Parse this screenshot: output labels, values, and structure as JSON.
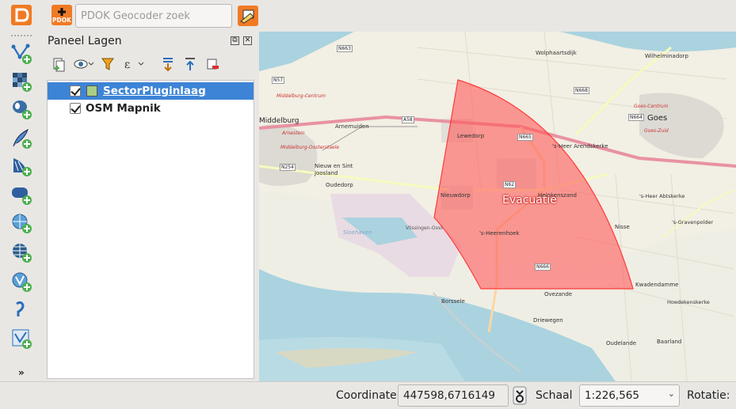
{
  "toolbar": {
    "search_placeholder": "PDOK Geocoder zoek",
    "pdok_badge": "PDOK",
    "icons": [
      "qgis-logo-icon",
      "pdok-plugin-icon",
      "clear-geocoder-icon"
    ]
  },
  "left_toolbar": {
    "icons": [
      "add-vector-layer-icon",
      "add-raster-layer-icon",
      "add-postgis-layer-icon",
      "add-spatialite-layer-icon",
      "add-mssql-layer-icon",
      "add-oracle-layer-icon",
      "add-wms-layer-icon",
      "add-wcs-layer-icon",
      "add-wfs-layer-icon",
      "add-delimited-text-layer-icon",
      "new-shapefile-layer-icon",
      "more-chevron-icon"
    ]
  },
  "layers_panel": {
    "title": "Paneel Lagen",
    "layers": [
      {
        "name": "SectorPluginlaag",
        "checked": true,
        "selected": true
      },
      {
        "name": "OSM Mapnik",
        "checked": true,
        "selected": false
      }
    ]
  },
  "map": {
    "polygon_label": "Evacuatie",
    "polygon_color": "#ff5a5a",
    "places": [
      "Wolphaartsdijk",
      "Wilhelminadorp",
      "Goes",
      "Lewedorp",
      "Nieuwdorp",
      "'s-Heer Arendskerke",
      "'s-Heer Abtskerke",
      "'s-Gravenpolder",
      "Oudedorp",
      "Arnemuiden",
      "Nieuw en Sint Joosland",
      "Borssele",
      "Ovezande",
      "Driewegen",
      "Oudelande",
      "Baarland",
      "Nisse",
      "Kwadendamme",
      "Hoedekenskerke",
      "Heinkenszand",
      "Vlissingen-Oost",
      "'s-Heerenhoek",
      "Sloehaven",
      "Middelburg-Centrum",
      "Middelburg-Oosterstaele",
      "Arnestein",
      "Goes-Centrum",
      "Goes-Zuid",
      "Middelburg"
    ],
    "roads": [
      "N663",
      "N668",
      "N57",
      "N664",
      "N665",
      "A58",
      "N62",
      "N254",
      "N666"
    ]
  },
  "status_bar": {
    "coordinate_label": "Coordinate:",
    "coordinate_value": "447598,6716149",
    "scale_label": "Schaal",
    "scale_value": "1:226,565",
    "rotation_label": "Rotatie:"
  }
}
